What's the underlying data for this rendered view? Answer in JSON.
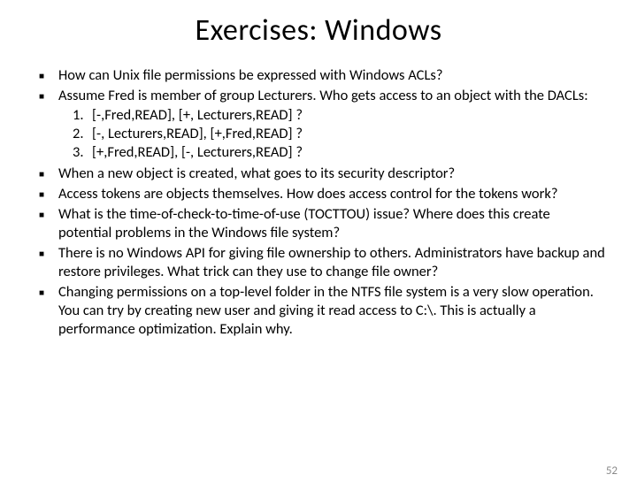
{
  "title": "Exercises: Windows",
  "bullets": [
    {
      "text": "How can Unix file permissions be expressed with Windows ACLs?"
    },
    {
      "text": "Assume Fred is member of group Lecturers. Who gets access to an object with the DACLs:",
      "sub": [
        "[-,Fred,READ], [+, Lecturers,READ] ?",
        "[-, Lecturers,READ], [+,Fred,READ] ?",
        "[+,Fred,READ], [-, Lecturers,READ] ?"
      ]
    },
    {
      "text": "When a new object is created, what goes to its security descriptor?"
    },
    {
      "text": "Access tokens are objects themselves. How does access control for the tokens work?"
    },
    {
      "text": "What is the time-of-check-to-time-of-use (TOCTTOU) issue? Where does this create potential problems in the Windows file system?"
    },
    {
      "text": "There is no Windows API for giving file ownership to others. Administrators have backup and restore privileges. What trick can they use to change file owner?"
    },
    {
      "text": "Changing permissions on a top-level folder in the NTFS file system is a very slow operation. You can try by creating new user and giving it read access to C:\\. This is actually a performance optimization. Explain why."
    }
  ],
  "page_number": "52"
}
